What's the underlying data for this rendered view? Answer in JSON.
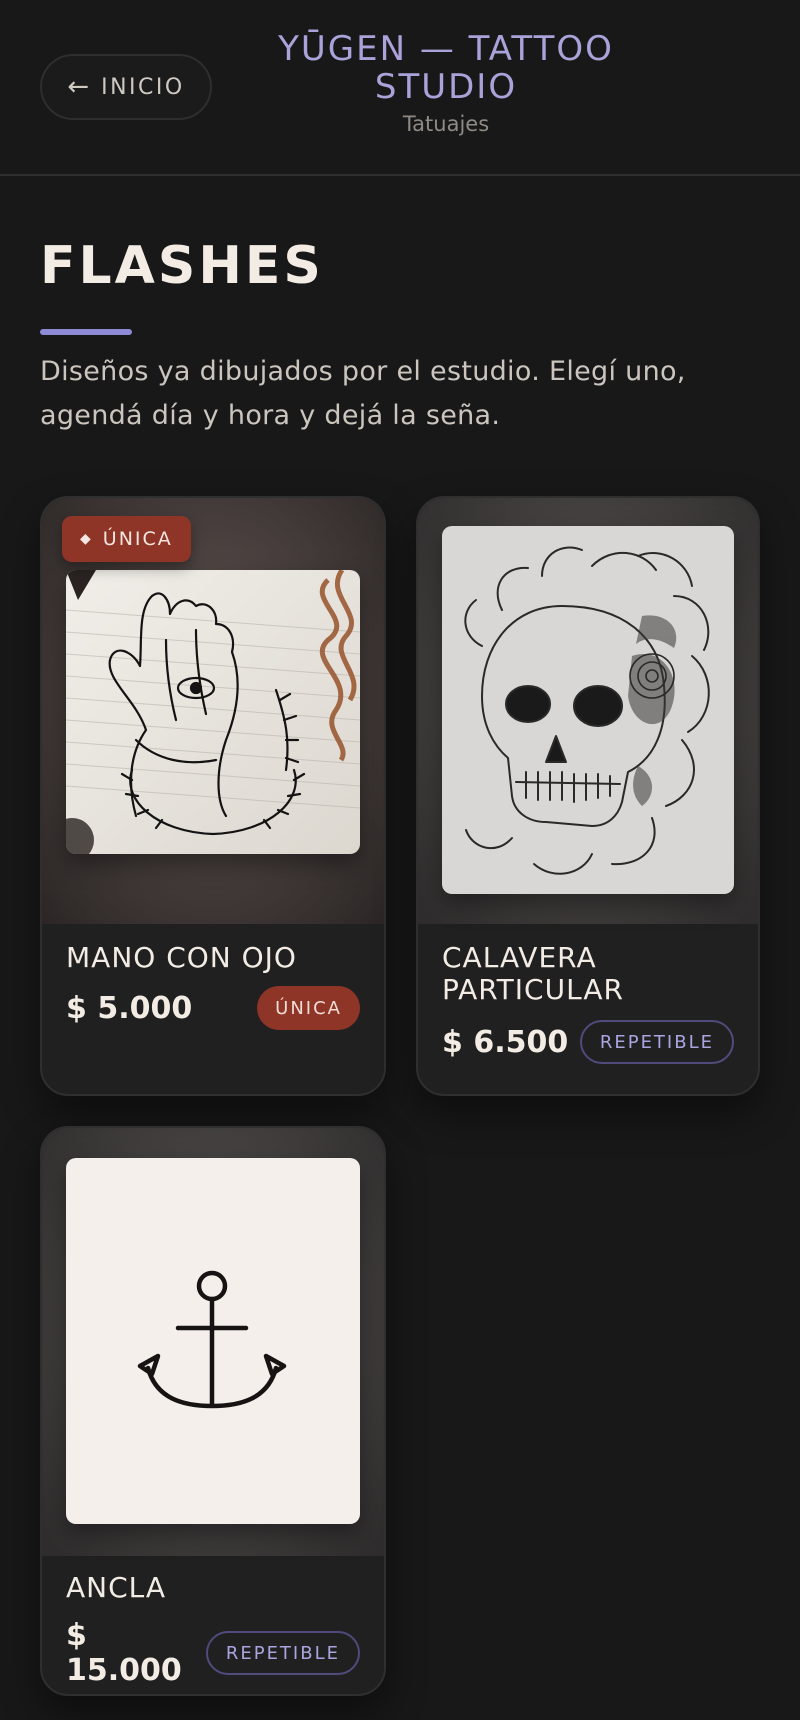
{
  "header": {
    "back_arrow": "←",
    "back_label": "INICIO",
    "brand_title": "YŪGEN — TATTOO STUDIO",
    "brand_subtitle": "Tatuajes"
  },
  "page": {
    "title": "FLASHES",
    "intro": "Diseños ya dibujados por el estudio. Elegí uno, agendá día y hora y dejá la seña."
  },
  "colors": {
    "accent": "#8e8ad6",
    "unique_badge": "#8f3528",
    "background": "#181818"
  },
  "flashes": [
    {
      "name": "MANO CON OJO",
      "price": "$ 5.000",
      "tag": "ÚNICA",
      "ribbon": "ÚNICA",
      "ribbon_icon": "◆",
      "image_icon": "hand-eye-illustration"
    },
    {
      "name": "CALAVERA PARTICULAR",
      "price": "$ 6.500",
      "tag": "REPETIBLE",
      "image_icon": "skull-illustration"
    },
    {
      "name": "ANCLA",
      "price": "$ 15.000",
      "tag": "REPETIBLE",
      "image_icon": "anchor-illustration"
    }
  ]
}
